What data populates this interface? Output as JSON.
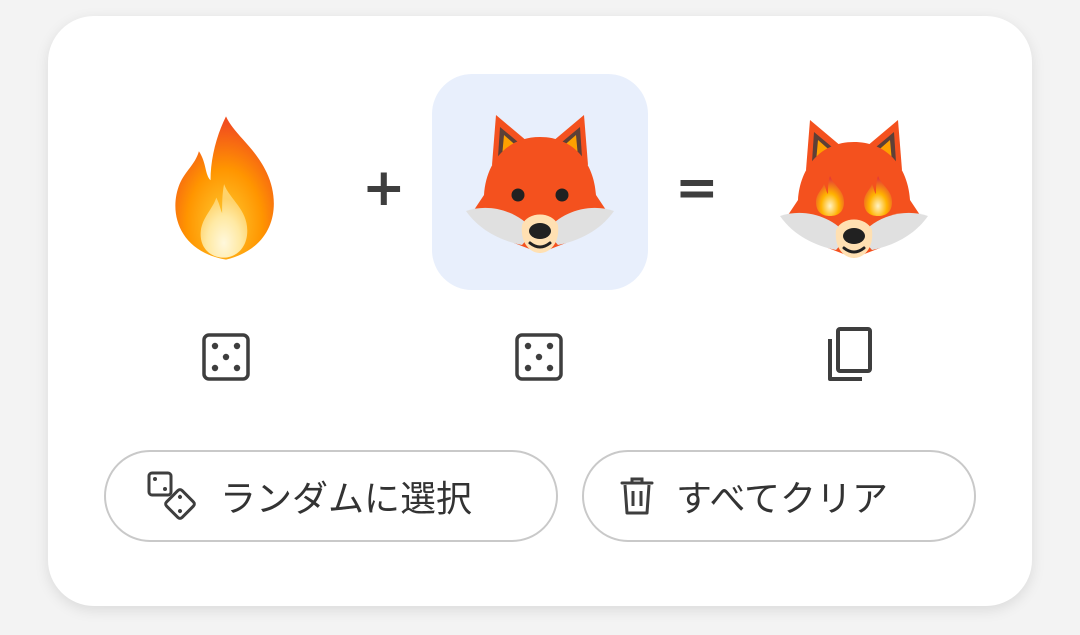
{
  "mixer": {
    "left_emoji": "fire",
    "middle_emoji": "fox",
    "result_emoji": "fox with fire eyes",
    "plus": "+",
    "equals": "="
  },
  "actions": {
    "random_label": "ランダムに選択",
    "clear_label": "すべてクリア"
  },
  "colors": {
    "card_bg": "#ffffff",
    "selected_slot_bg": "#e8effc",
    "fox_orange": "#f4511e",
    "fire_orange": "#ff9800",
    "icon_gray": "#3e3e3e",
    "pill_border": "#c9c9c9"
  }
}
